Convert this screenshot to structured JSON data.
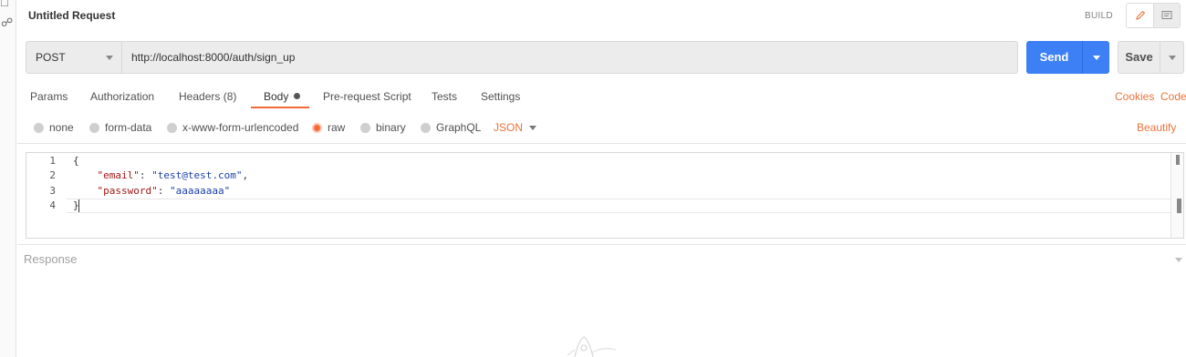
{
  "request": {
    "title": "Untitled Request",
    "build_label": "BUILD",
    "method": "POST",
    "url": "http://localhost:8000/auth/sign_up",
    "send_label": "Send",
    "save_label": "Save"
  },
  "tabs": [
    {
      "label": "Params"
    },
    {
      "label": "Authorization"
    },
    {
      "label": "Headers (8)"
    },
    {
      "label": "Body"
    },
    {
      "label": "Pre-request Script"
    },
    {
      "label": "Tests"
    },
    {
      "label": "Settings"
    }
  ],
  "active_tab": "Body",
  "links": {
    "cookies": "Cookies",
    "code": "Code"
  },
  "body_types": [
    {
      "label": "none"
    },
    {
      "label": "form-data"
    },
    {
      "label": "x-www-form-urlencoded"
    },
    {
      "label": "raw"
    },
    {
      "label": "binary"
    },
    {
      "label": "GraphQL"
    }
  ],
  "selected_body_type": "raw",
  "raw_format": "JSON",
  "beautify_label": "Beautify",
  "editor": {
    "line_numbers": [
      "1",
      "2",
      "3",
      "4"
    ],
    "line1": "{",
    "line2_key": "\"email\"",
    "line2_sep": ": ",
    "line2_value": "\"test@test.com\"",
    "line2_end": ",",
    "line3_key": "\"password\"",
    "line3_sep": ": ",
    "line3_value": "\"aaaaaaaa\"",
    "line4": "}"
  },
  "response_label": "Response",
  "colors": {
    "accent": "#f26b3a",
    "send": "#3d7ff4",
    "link": "#e8733b"
  },
  "icons": [
    "history-icon",
    "share-icon",
    "pencil-icon",
    "comment-icon",
    "chevron-down-icon",
    "rocket-illustration"
  ]
}
